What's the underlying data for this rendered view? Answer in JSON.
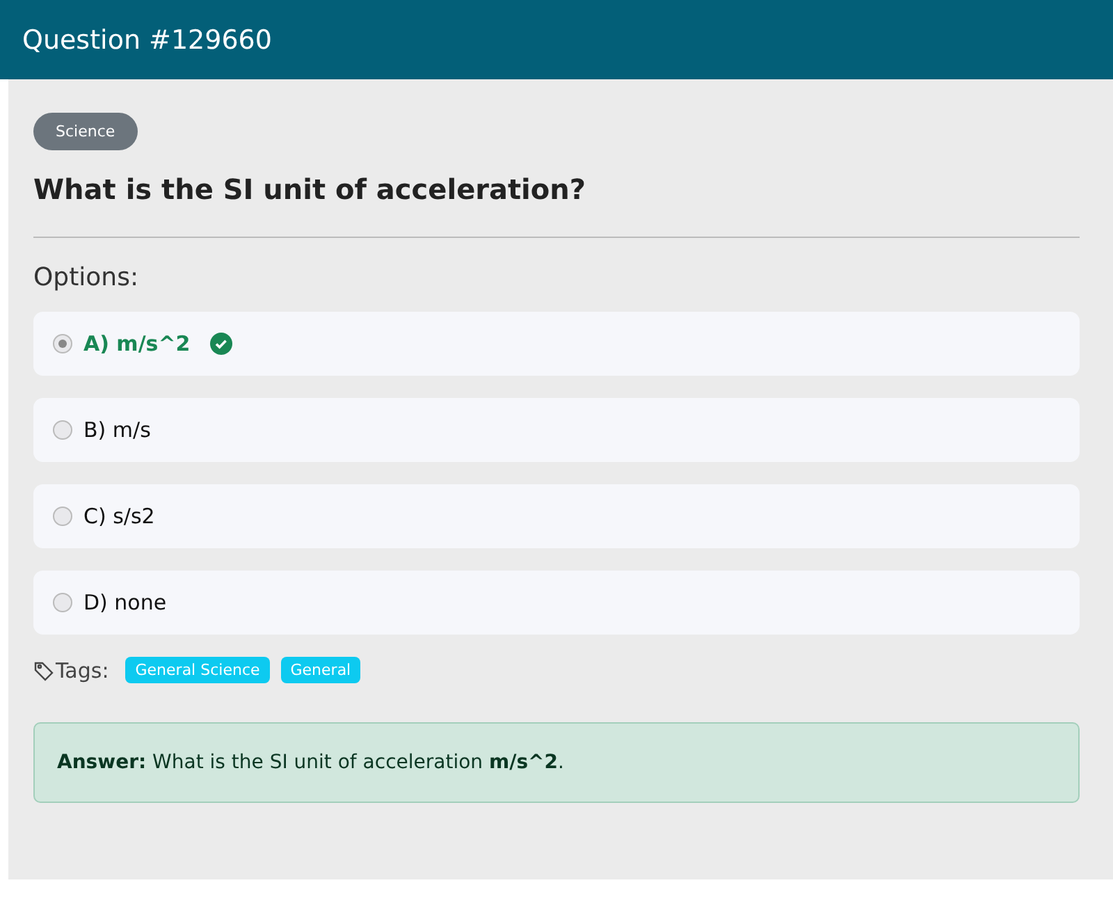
{
  "header": {
    "title": "Question #129660"
  },
  "category": "Science",
  "question": "What is the SI unit of acceleration?",
  "options_label": "Options:",
  "options": [
    {
      "label": "A) m/s^2",
      "selected": true,
      "correct": true
    },
    {
      "label": "B) m/s",
      "selected": false,
      "correct": false
    },
    {
      "label": "C) s/s2",
      "selected": false,
      "correct": false
    },
    {
      "label": "D) none",
      "selected": false,
      "correct": false
    }
  ],
  "tags_label": "Tags:",
  "tags": [
    "General Science",
    "General"
  ],
  "answer": "**Answer:** What is the SI unit of acceleration **m/s^2**."
}
